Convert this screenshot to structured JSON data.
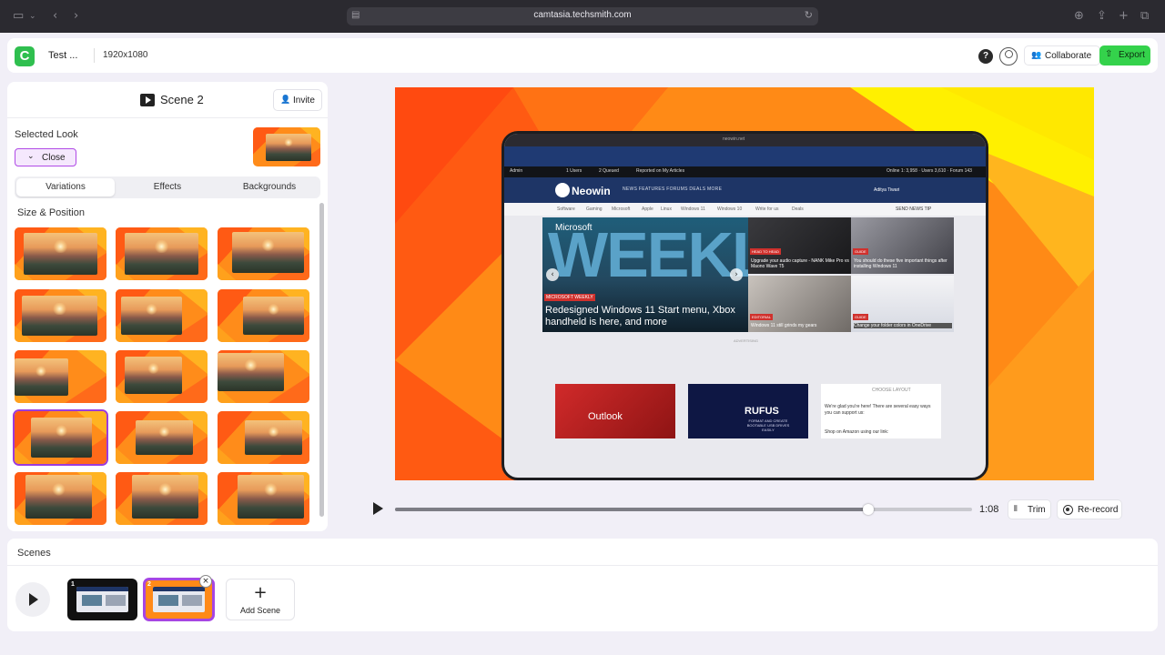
{
  "browser": {
    "url": "camtasia.techsmith.com"
  },
  "header": {
    "project_name": "Test ...",
    "resolution": "1920x1080",
    "help_label": "?",
    "collaborate_label": "Collaborate",
    "export_label": "Export",
    "brand_color": "#2fbf4f",
    "export_color": "#34d24b"
  },
  "panel": {
    "scene_title": "Scene 2",
    "invite_label": "Invite",
    "selected_look_label": "Selected Look",
    "close_label": "Close",
    "tabs": [
      {
        "label": "Variations",
        "active": true
      },
      {
        "label": "Effects",
        "active": false
      },
      {
        "label": "Backgrounds",
        "active": false
      }
    ],
    "section_label": "Size & Position",
    "selected_variation": 9,
    "variation_count": 15
  },
  "preview": {
    "device_url": "neowin.net",
    "top_strip": [
      "Admin",
      "1 Users",
      "2 Queued",
      "Reported on My Articles",
      "Online 1: 3,958 · Users 3,610 · Forum 143"
    ],
    "site_name": "Neowin",
    "nav_items": "NEWS    FEATURES    FORUMS    DEALS    MORE",
    "nav_user": "Aditya Tiwari",
    "sub_nav": [
      "Software",
      "Gaming",
      "Microsoft",
      "Apple",
      "Linux",
      "Windows 11",
      "Windows 10",
      "Write for us",
      "Deals"
    ],
    "send_news": "SEND NEWS TIP",
    "hero_brand": "Microsoft",
    "hero_word": "WEEKLY",
    "hero_tag": "MICROSOFT WEEKLY",
    "hero_title": "Redesigned Windows 11 Start menu, Xbox handheld is here, and more",
    "cards": [
      {
        "tag": "HEAD TO HEAD",
        "text": "Upgrade your audio capture - NANK Mike Pro vs Maono Wave T5"
      },
      {
        "tag": "GUIDE",
        "text": "You should do these five important things after installing Windows 11"
      },
      {
        "tag": "EDITORIAL",
        "text": "Windows 11 still grinds my gears"
      },
      {
        "tag": "GUIDE",
        "text": "Change your folder colors in OneDrive"
      }
    ],
    "ad_label": "ADVERTISING",
    "outlook_label": "Outlook",
    "rufus_title": "RUFUS",
    "rufus_sub": "FORMAT AND CREATE BOOTABLE USB DRIVES EASILY",
    "layout_label": "CHOOSE LAYOUT",
    "side_text": "We're glad you're here! There are several easy ways you can support us:",
    "side_shop": "Shop on Amazon using our link:"
  },
  "player": {
    "duration": "1:08",
    "progress": 0.82,
    "trim_label": "Trim",
    "rerecord_label": "Re-record"
  },
  "scenes": {
    "label": "Scenes",
    "items": [
      {
        "number": "1"
      },
      {
        "number": "2"
      }
    ],
    "remove_label": "×",
    "add_label": "Add Scene",
    "add_icon": "+"
  }
}
